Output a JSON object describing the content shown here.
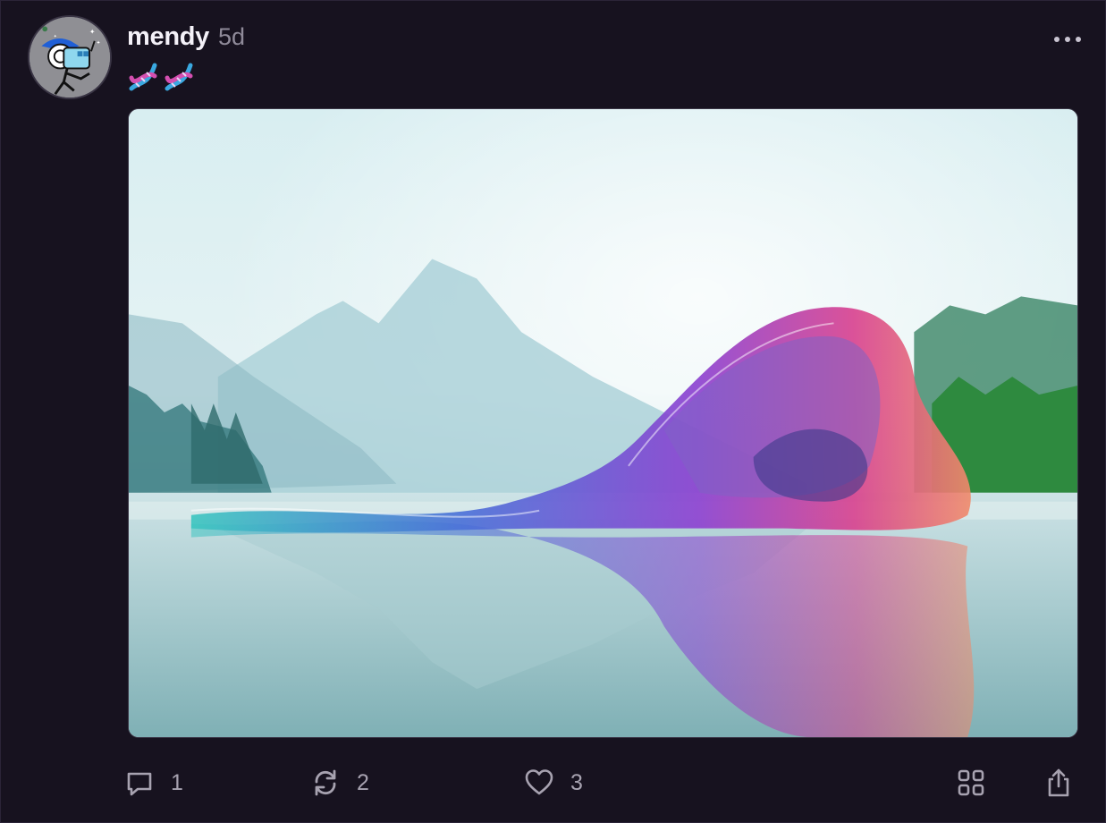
{
  "post": {
    "author": "mendy",
    "time": "5d",
    "caption_emoji": [
      "dna-emoji",
      "dna-emoji"
    ]
  },
  "media": {
    "description": "image"
  },
  "actions": {
    "replies": "1",
    "reposts": "2",
    "likes": "3"
  },
  "icons": [
    "more-icon",
    "reply-icon",
    "repost-icon",
    "heart-icon",
    "grid-icon",
    "share-icon"
  ],
  "colors": {
    "background": "#17121f",
    "text": "#f4f1f8",
    "muted": "#8f8a99",
    "icon": "#a7a2b0"
  }
}
